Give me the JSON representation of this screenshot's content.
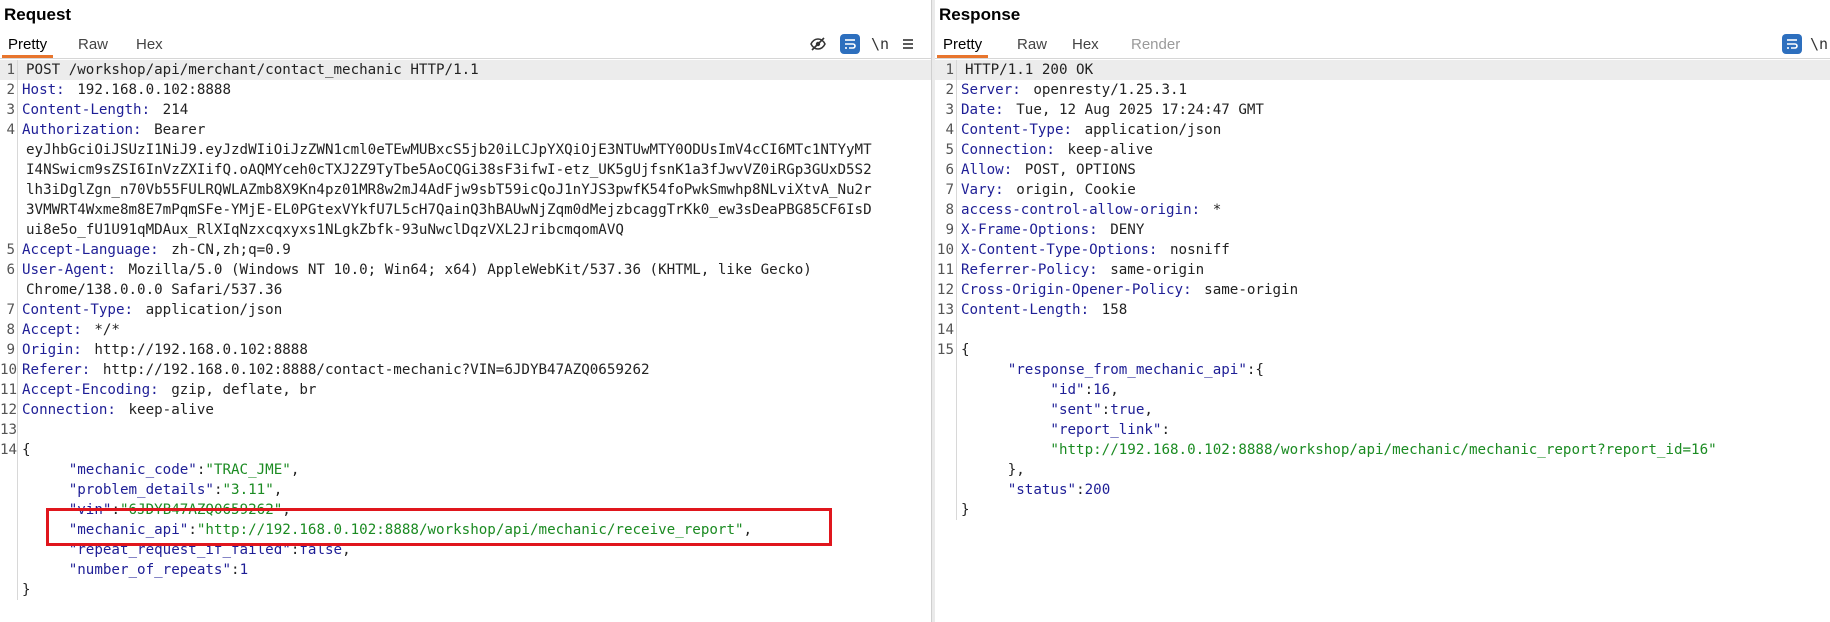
{
  "request": {
    "title": "Request",
    "tabs": [
      "Pretty",
      "Raw",
      "Hex"
    ],
    "toolbar": {
      "hide_icon": "eye-off",
      "wrap_icon": "wrap",
      "newline_label": "\\n",
      "menu_icon": "hamburger"
    },
    "lines": [
      {
        "n": "1",
        "segs": [
          {
            "t": "POST /workshop/api/merchant/contact_mechanic HTTP/1.1",
            "c": "txt"
          }
        ]
      },
      {
        "n": "2",
        "segs": [
          {
            "t": "Host:",
            "c": "hdr"
          },
          {
            "t": " 192.168.0.102:8888",
            "c": "txt"
          }
        ]
      },
      {
        "n": "3",
        "segs": [
          {
            "t": "Content-Length:",
            "c": "hdr"
          },
          {
            "t": " 214",
            "c": "txt"
          }
        ]
      },
      {
        "n": "4",
        "segs": [
          {
            "t": "Authorization:",
            "c": "hdr"
          },
          {
            "t": " Bearer",
            "c": "txt"
          }
        ]
      },
      {
        "n": "",
        "segs": [
          {
            "t": "eyJhbGciOiJSUzI1NiJ9.eyJzdWIiOiJzZWN1cml0eTEwMUBxcS5jb20iLCJpYXQiOjE3NTUwMTY0ODUsImV4cCI6MTc1NTYyMT",
            "c": "txt"
          }
        ]
      },
      {
        "n": "",
        "segs": [
          {
            "t": "I4NSwicm9sZSI6InVzZXIifQ.oAQMYceh0cTXJ2Z9TyTbe5AoCQGi38sF3ifwI-etz_UK5gUjfsnK1a3fJwvVZ0iRGp3GUxD5S2",
            "c": "txt"
          }
        ]
      },
      {
        "n": "",
        "segs": [
          {
            "t": "lh3iDglZgn_n70Vb55FULRQWLAZmb8X9Kn4pz01MR8w2mJ4AdFjw9sbT59icQoJ1nYJS3pwfK54foPwkSmwhp8NLviXtvA_Nu2r",
            "c": "txt"
          }
        ]
      },
      {
        "n": "",
        "segs": [
          {
            "t": "3VMWRT4Wxme8m8E7mPqmSFe-YMjE-EL0PGtexVYkfU7L5cH7QainQ3hBAUwNjZqm0dMejzbcaggTrKk0_ew3sDeaPBG85CF6IsD",
            "c": "txt"
          }
        ]
      },
      {
        "n": "",
        "segs": [
          {
            "t": "ui8e5o_fU1U91qMDAux_RlXIqNzxcqxyxs1NLgkZbfk-93uNwclDqzVXL2JribcmqomAVQ",
            "c": "txt"
          }
        ]
      },
      {
        "n": "5",
        "segs": [
          {
            "t": "Accept-Language:",
            "c": "hdr"
          },
          {
            "t": " zh-CN,zh;q=0.9",
            "c": "txt"
          }
        ]
      },
      {
        "n": "6",
        "segs": [
          {
            "t": "User-Agent:",
            "c": "hdr"
          },
          {
            "t": " Mozilla/5.0 (Windows NT 10.0; Win64; x64) AppleWebKit/537.36 (KHTML, like Gecko)",
            "c": "txt"
          }
        ]
      },
      {
        "n": "",
        "segs": [
          {
            "t": "Chrome/138.0.0.0 Safari/537.36",
            "c": "txt"
          }
        ]
      },
      {
        "n": "7",
        "segs": [
          {
            "t": "Content-Type:",
            "c": "hdr"
          },
          {
            "t": " application/json",
            "c": "txt"
          }
        ]
      },
      {
        "n": "8",
        "segs": [
          {
            "t": "Accept:",
            "c": "hdr"
          },
          {
            "t": " */*",
            "c": "txt"
          }
        ]
      },
      {
        "n": "9",
        "segs": [
          {
            "t": "Origin:",
            "c": "hdr"
          },
          {
            "t": " http://192.168.0.102:8888",
            "c": "txt"
          }
        ]
      },
      {
        "n": "10",
        "segs": [
          {
            "t": "Referer:",
            "c": "hdr"
          },
          {
            "t": " http://192.168.0.102:8888/contact-mechanic?VIN=6JDYB47AZQ0659262",
            "c": "txt"
          }
        ]
      },
      {
        "n": "11",
        "segs": [
          {
            "t": "Accept-Encoding:",
            "c": "hdr"
          },
          {
            "t": " gzip, deflate, br",
            "c": "txt"
          }
        ]
      },
      {
        "n": "12",
        "segs": [
          {
            "t": "Connection:",
            "c": "hdr"
          },
          {
            "t": " keep-alive",
            "c": "txt"
          }
        ]
      },
      {
        "n": "13",
        "segs": []
      },
      {
        "n": "14",
        "segs": [
          {
            "t": "{",
            "c": "punc"
          }
        ]
      },
      {
        "n": "",
        "segs": [
          {
            "t": "     ",
            "c": "txt"
          },
          {
            "t": "\"mechanic_code\"",
            "c": "key"
          },
          {
            "t": ":",
            "c": "punc"
          },
          {
            "t": "\"TRAC_JME\"",
            "c": "str"
          },
          {
            "t": ",",
            "c": "punc"
          }
        ]
      },
      {
        "n": "",
        "segs": [
          {
            "t": "     ",
            "c": "txt"
          },
          {
            "t": "\"problem_details\"",
            "c": "key"
          },
          {
            "t": ":",
            "c": "punc"
          },
          {
            "t": "\"3.11\"",
            "c": "str"
          },
          {
            "t": ",",
            "c": "punc"
          }
        ]
      },
      {
        "n": "",
        "segs": [
          {
            "t": "     ",
            "c": "txt"
          },
          {
            "t": "\"vin\"",
            "c": "key"
          },
          {
            "t": ":",
            "c": "punc"
          },
          {
            "t": "\"6JDYB47AZQ0659262\"",
            "c": "str"
          },
          {
            "t": ",",
            "c": "punc"
          }
        ]
      },
      {
        "n": "",
        "segs": [
          {
            "t": "     ",
            "c": "txt"
          },
          {
            "t": "\"mechanic_api\"",
            "c": "key"
          },
          {
            "t": ":",
            "c": "punc"
          },
          {
            "t": "\"http://192.168.0.102:8888/workshop/api/mechanic/receive_report\"",
            "c": "str"
          },
          {
            "t": ",",
            "c": "punc"
          }
        ]
      },
      {
        "n": "",
        "segs": [
          {
            "t": "     ",
            "c": "txt"
          },
          {
            "t": "\"repeat_request_if_failed\"",
            "c": "key"
          },
          {
            "t": ":",
            "c": "punc"
          },
          {
            "t": "false",
            "c": "num"
          },
          {
            "t": ",",
            "c": "punc"
          }
        ]
      },
      {
        "n": "",
        "segs": [
          {
            "t": "     ",
            "c": "txt"
          },
          {
            "t": "\"number_of_repeats\"",
            "c": "key"
          },
          {
            "t": ":",
            "c": "punc"
          },
          {
            "t": "1",
            "c": "num"
          }
        ]
      },
      {
        "n": "",
        "segs": [
          {
            "t": "}",
            "c": "punc"
          }
        ]
      }
    ]
  },
  "response": {
    "title": "Response",
    "tabs": [
      "Pretty",
      "Raw",
      "Hex",
      "Render"
    ],
    "toolbar": {
      "wrap_icon": "wrap",
      "newline_label": "\\n"
    },
    "lines": [
      {
        "n": "1",
        "segs": [
          {
            "t": "HTTP/1.1 200 OK",
            "c": "txt"
          }
        ]
      },
      {
        "n": "2",
        "segs": [
          {
            "t": "Server:",
            "c": "hdr"
          },
          {
            "t": " openresty/1.25.3.1",
            "c": "txt"
          }
        ]
      },
      {
        "n": "3",
        "segs": [
          {
            "t": "Date:",
            "c": "hdr"
          },
          {
            "t": " Tue, 12 Aug 2025 17:24:47 GMT",
            "c": "txt"
          }
        ]
      },
      {
        "n": "4",
        "segs": [
          {
            "t": "Content-Type:",
            "c": "hdr"
          },
          {
            "t": " application/json",
            "c": "txt"
          }
        ]
      },
      {
        "n": "5",
        "segs": [
          {
            "t": "Connection:",
            "c": "hdr"
          },
          {
            "t": " keep-alive",
            "c": "txt"
          }
        ]
      },
      {
        "n": "6",
        "segs": [
          {
            "t": "Allow:",
            "c": "hdr"
          },
          {
            "t": " POST, OPTIONS",
            "c": "txt"
          }
        ]
      },
      {
        "n": "7",
        "segs": [
          {
            "t": "Vary:",
            "c": "hdr"
          },
          {
            "t": " origin, Cookie",
            "c": "txt"
          }
        ]
      },
      {
        "n": "8",
        "segs": [
          {
            "t": "access-control-allow-origin:",
            "c": "hdr"
          },
          {
            "t": " *",
            "c": "txt"
          }
        ]
      },
      {
        "n": "9",
        "segs": [
          {
            "t": "X-Frame-Options:",
            "c": "hdr"
          },
          {
            "t": " DENY",
            "c": "txt"
          }
        ]
      },
      {
        "n": "10",
        "segs": [
          {
            "t": "X-Content-Type-Options:",
            "c": "hdr"
          },
          {
            "t": " nosniff",
            "c": "txt"
          }
        ]
      },
      {
        "n": "11",
        "segs": [
          {
            "t": "Referrer-Policy:",
            "c": "hdr"
          },
          {
            "t": " same-origin",
            "c": "txt"
          }
        ]
      },
      {
        "n": "12",
        "segs": [
          {
            "t": "Cross-Origin-Opener-Policy:",
            "c": "hdr"
          },
          {
            "t": " same-origin",
            "c": "txt"
          }
        ]
      },
      {
        "n": "13",
        "segs": [
          {
            "t": "Content-Length:",
            "c": "hdr"
          },
          {
            "t": " 158",
            "c": "txt"
          }
        ]
      },
      {
        "n": "14",
        "segs": []
      },
      {
        "n": "15",
        "segs": [
          {
            "t": "{",
            "c": "punc"
          }
        ]
      },
      {
        "n": "",
        "segs": [
          {
            "t": "     ",
            "c": "txt"
          },
          {
            "t": "\"response_from_mechanic_api\"",
            "c": "key"
          },
          {
            "t": ":{",
            "c": "punc"
          }
        ]
      },
      {
        "n": "",
        "segs": [
          {
            "t": "          ",
            "c": "txt"
          },
          {
            "t": "\"id\"",
            "c": "key"
          },
          {
            "t": ":",
            "c": "punc"
          },
          {
            "t": "16",
            "c": "num"
          },
          {
            "t": ",",
            "c": "punc"
          }
        ]
      },
      {
        "n": "",
        "segs": [
          {
            "t": "          ",
            "c": "txt"
          },
          {
            "t": "\"sent\"",
            "c": "key"
          },
          {
            "t": ":",
            "c": "punc"
          },
          {
            "t": "true",
            "c": "num"
          },
          {
            "t": ",",
            "c": "punc"
          }
        ]
      },
      {
        "n": "",
        "segs": [
          {
            "t": "          ",
            "c": "txt"
          },
          {
            "t": "\"report_link\"",
            "c": "key"
          },
          {
            "t": ":",
            "c": "punc"
          }
        ]
      },
      {
        "n": "",
        "segs": [
          {
            "t": "          ",
            "c": "txt"
          },
          {
            "t": "\"http://192.168.0.102:8888/workshop/api/mechanic/mechanic_report?report_id=16\"",
            "c": "str"
          }
        ]
      },
      {
        "n": "",
        "segs": [
          {
            "t": "     ",
            "c": "txt"
          },
          {
            "t": "},",
            "c": "punc"
          }
        ]
      },
      {
        "n": "",
        "segs": [
          {
            "t": "     ",
            "c": "txt"
          },
          {
            "t": "\"status\"",
            "c": "key"
          },
          {
            "t": ":",
            "c": "punc"
          },
          {
            "t": "200",
            "c": "num"
          }
        ]
      },
      {
        "n": "",
        "segs": [
          {
            "t": "}",
            "c": "punc"
          }
        ]
      }
    ]
  }
}
